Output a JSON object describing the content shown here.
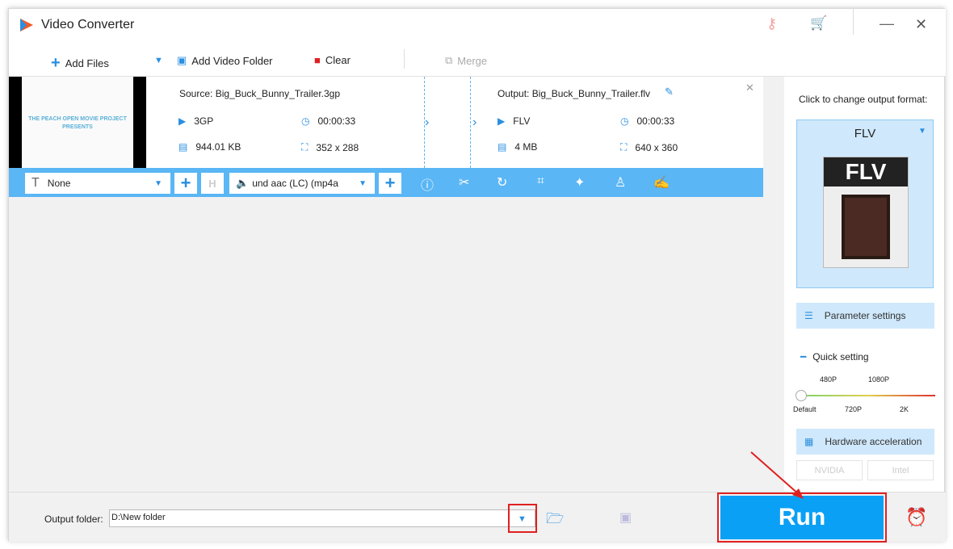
{
  "app": {
    "title": "Video Converter"
  },
  "toolbar": {
    "add_files": "Add Files",
    "add_folder": "Add Video Folder",
    "clear": "Clear",
    "merge": "Merge"
  },
  "item": {
    "thumb_line1": "THE PEACH OPEN MOVIE PROJECT",
    "thumb_line2": "PRESENTS",
    "source": "Source: Big_Buck_Bunny_Trailer.3gp",
    "src_format": "3GP",
    "src_duration": "00:00:33",
    "src_size": "944.01 KB",
    "src_res": "352 x 288",
    "output": "Output: Big_Buck_Bunny_Trailer.flv",
    "out_format": "FLV",
    "out_duration": "00:00:33",
    "out_size": "4 MB",
    "out_res": "640 x 360"
  },
  "editbar": {
    "subtitle": "None",
    "audio": "und aac (LC) (mp4a"
  },
  "side": {
    "hint": "Click to change output format:",
    "format": "FLV",
    "format_icon_text": "FLV",
    "param": "Parameter settings",
    "quick": "Quick setting",
    "ticks_top": [
      "480P",
      "1080P"
    ],
    "ticks_bottom": [
      "Default",
      "720P",
      "2K"
    ],
    "quality_level": 0,
    "hw": "Hardware acceleration",
    "nvidia": "NVIDIA",
    "intel": "Intel"
  },
  "bottom": {
    "label": "Output folder:",
    "path": "D:\\New folder",
    "run": "Run"
  },
  "colors": {
    "accent": "#2a8fe0",
    "run": "#0aa0f5",
    "highlight": "#e02020"
  }
}
